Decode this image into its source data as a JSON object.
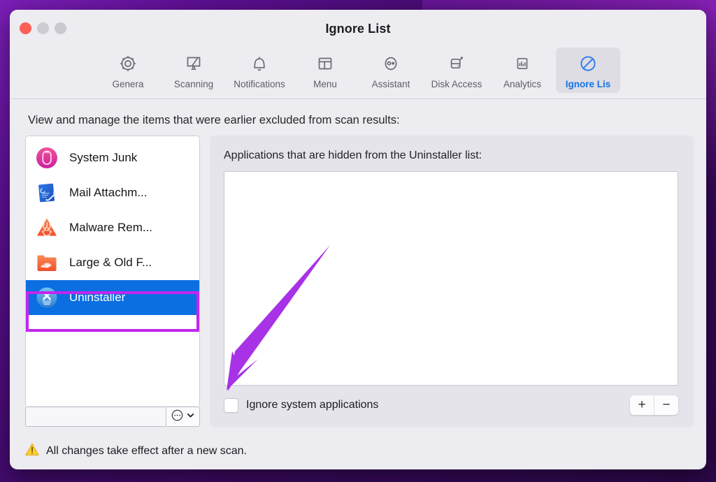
{
  "window": {
    "title": "Ignore List",
    "traffic_lights": [
      "close-button",
      "minimize-button",
      "maximize-button"
    ]
  },
  "toolbar": {
    "tabs": [
      {
        "label": "Genera",
        "icon": "gear-icon",
        "active": false
      },
      {
        "label": "Scanning",
        "icon": "scanner-icon",
        "active": false
      },
      {
        "label": "Notifications",
        "icon": "bell-icon",
        "active": false
      },
      {
        "label": "Menu",
        "icon": "menubar-icon",
        "active": false
      },
      {
        "label": "Assistant",
        "icon": "assistant-icon",
        "active": false
      },
      {
        "label": "Disk Access",
        "icon": "disk-icon",
        "active": false
      },
      {
        "label": "Analytics",
        "icon": "bar-chart-icon",
        "active": false
      },
      {
        "label": "Ignore Lis",
        "icon": "no-entry-icon",
        "active": true
      }
    ]
  },
  "content": {
    "intro": "View and manage the items that were earlier excluded from scan results:"
  },
  "sidebar": {
    "items": [
      {
        "label": "System Junk",
        "icon": "system-junk-icon",
        "selected": false
      },
      {
        "label": "Mail Attachm...",
        "icon": "mail-attachment-icon",
        "selected": false
      },
      {
        "label": "Malware Rem...",
        "icon": "biohazard-icon",
        "selected": false
      },
      {
        "label": "Large & Old F...",
        "icon": "large-old-files-icon",
        "selected": false
      },
      {
        "label": "Uninstaller",
        "icon": "uninstaller-icon",
        "selected": true
      }
    ],
    "filter": {
      "value": "",
      "placeholder": ""
    },
    "action_menu": {
      "icon": "ellipsis-circle-icon",
      "chevron": "chevron-down-icon"
    }
  },
  "main": {
    "list_caption": "Applications that are hidden from the Uninstaller list:",
    "list_items": [],
    "ignore_system_apps": {
      "label": "Ignore system applications",
      "checked": false
    },
    "add_button": "+",
    "remove_button": "−"
  },
  "status": {
    "icon": "warning-triangle-icon",
    "message": "All changes take effect after a new scan."
  },
  "annotations": {
    "highlight_color": "#c326ef",
    "arrow_color": "#a832e6",
    "selection_color": "#0b6fe2",
    "accent_color": "#1274e8"
  }
}
